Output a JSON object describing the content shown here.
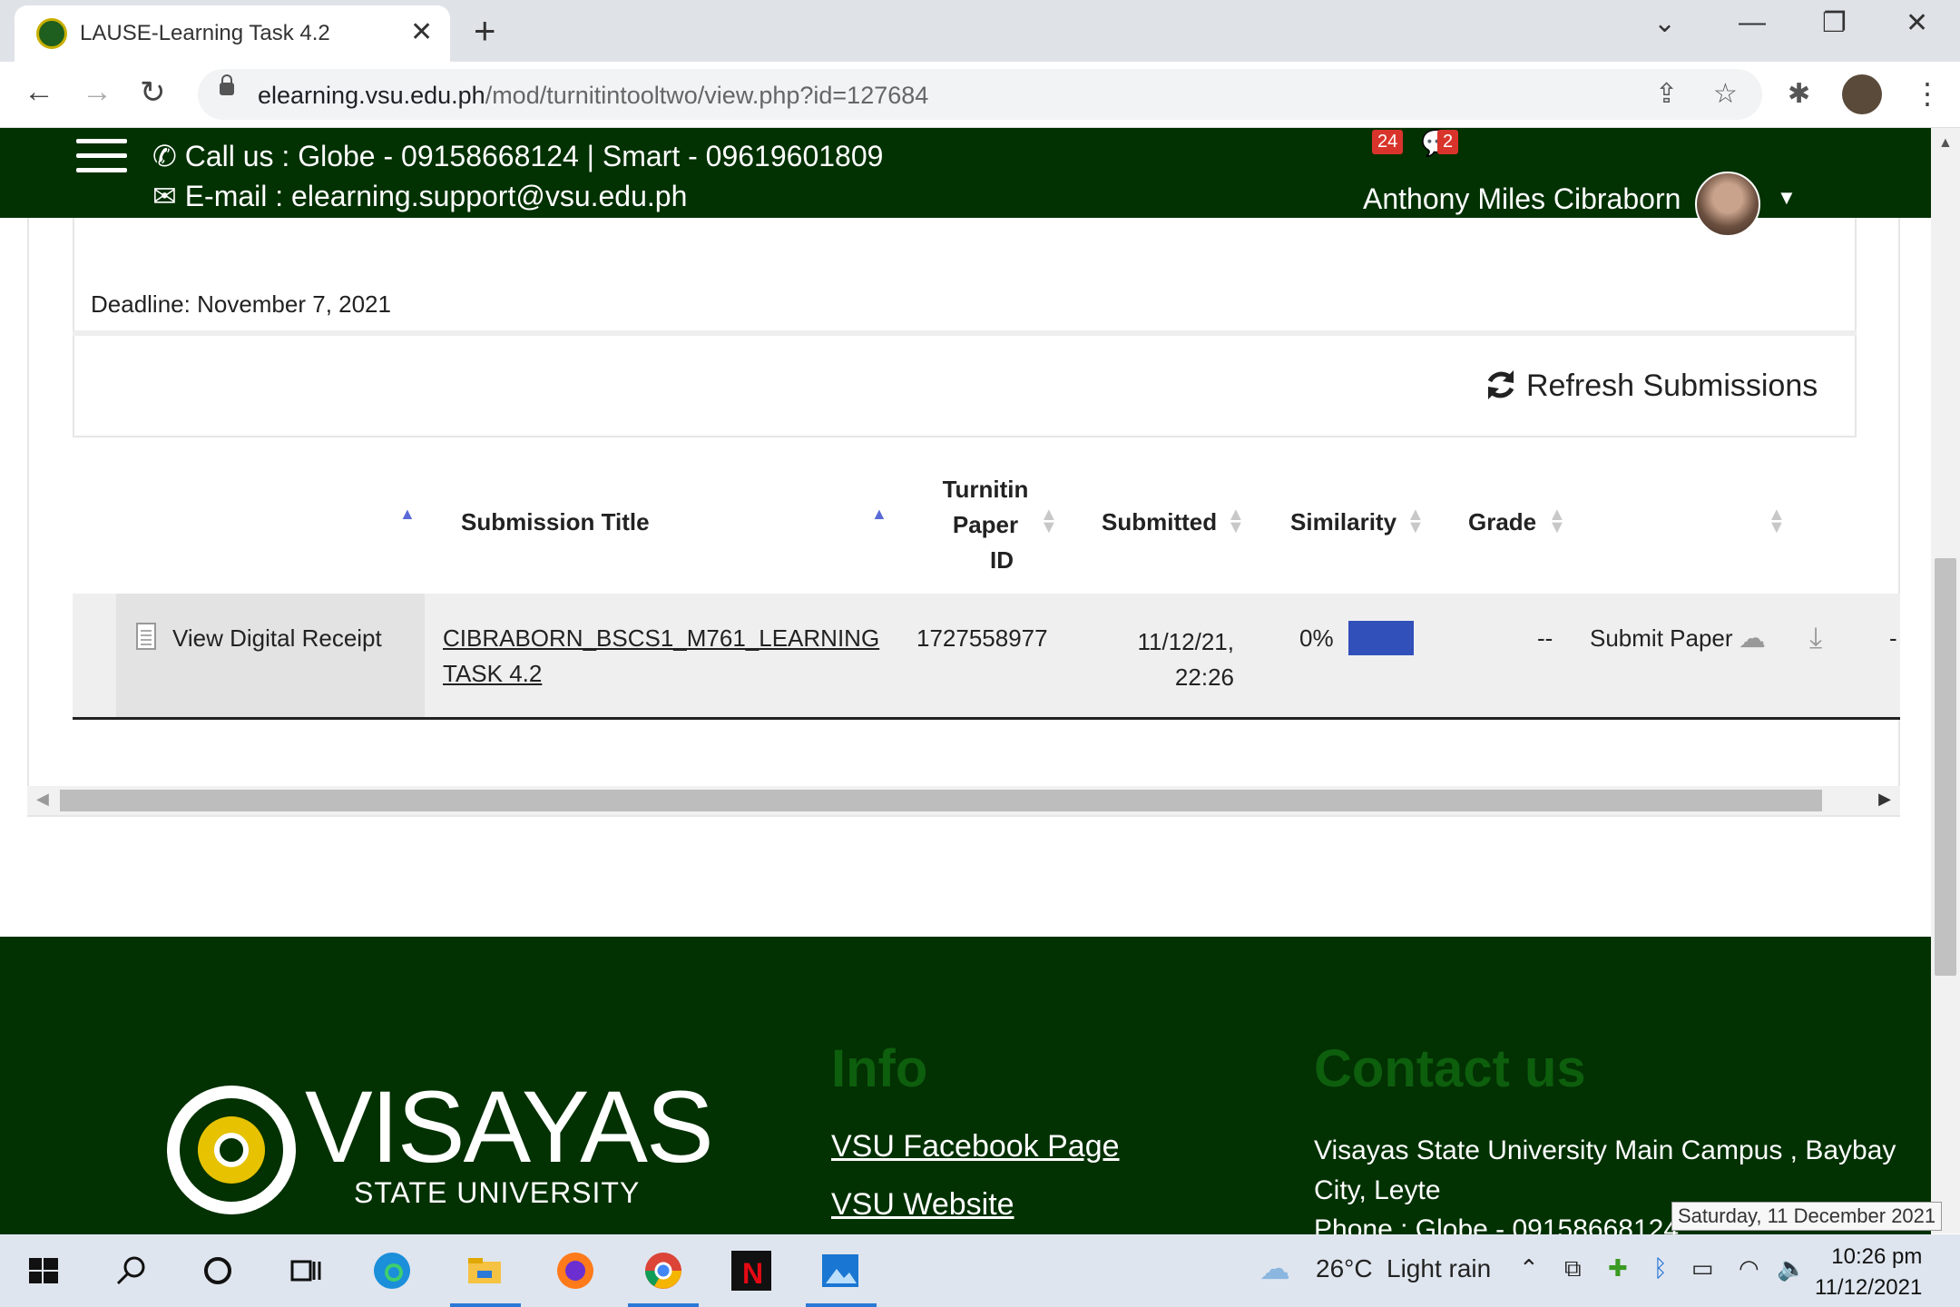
{
  "browser": {
    "tab_title": "LAUSE-Learning Task 4.2",
    "tab_close": "✕",
    "new_tab": "+",
    "url_host": "elearning.vsu.edu.ph",
    "url_path": "/mod/turnitintooltwo/view.php?id=127684"
  },
  "header": {
    "call": "Call us : Globe - 09158668124  |  Smart - 09619601809",
    "email": "E-mail : elearning.support@vsu.edu.ph",
    "notifications_count": "24",
    "messages_count": "2",
    "user_name": "Anthony Miles Cibraborn"
  },
  "assignment": {
    "deadline": "Deadline: November 7, 2021",
    "refresh_label": "Refresh Submissions"
  },
  "table": {
    "headers": {
      "submission_title": "Submission Title",
      "paper_id_1": "Turnitin",
      "paper_id_2": "Paper",
      "paper_id_3": "ID",
      "submitted": "Submitted",
      "similarity": "Similarity",
      "grade": "Grade"
    },
    "row": {
      "receipt": "View Digital Receipt",
      "title_line1": "CIBRABORN_BSCS1_M761_LEARNING",
      "title_line2": "TASK 4.2",
      "paper_id": "1727558977",
      "submitted_date": "11/12/21,",
      "submitted_time": "22:26",
      "similarity": "0%",
      "grade": "--",
      "submit_paper": "Submit Paper",
      "trailing": "-"
    }
  },
  "footer": {
    "logo_main": "VISAYAS",
    "logo_sub": "STATE UNIVERSITY",
    "info_heading": "Info",
    "link_facebook": "VSU Facebook Page",
    "link_website": "VSU Website",
    "contact_heading": "Contact us",
    "address": "Visayas State University Main Campus , Baybay City, Leyte",
    "phone_partial": "Phone : Globe - 09158668124"
  },
  "taskbar": {
    "weather_temp": "26°C",
    "weather_desc": "Light rain",
    "time": "10:26 pm",
    "date": "11/12/2021",
    "date_tooltip": "Saturday, 11 December 2021"
  },
  "colors": {
    "header_green": "#023102",
    "footer_heading_green": "#0d5e0d",
    "similarity_blue": "#3150b9",
    "badge_red": "#d9342b"
  }
}
